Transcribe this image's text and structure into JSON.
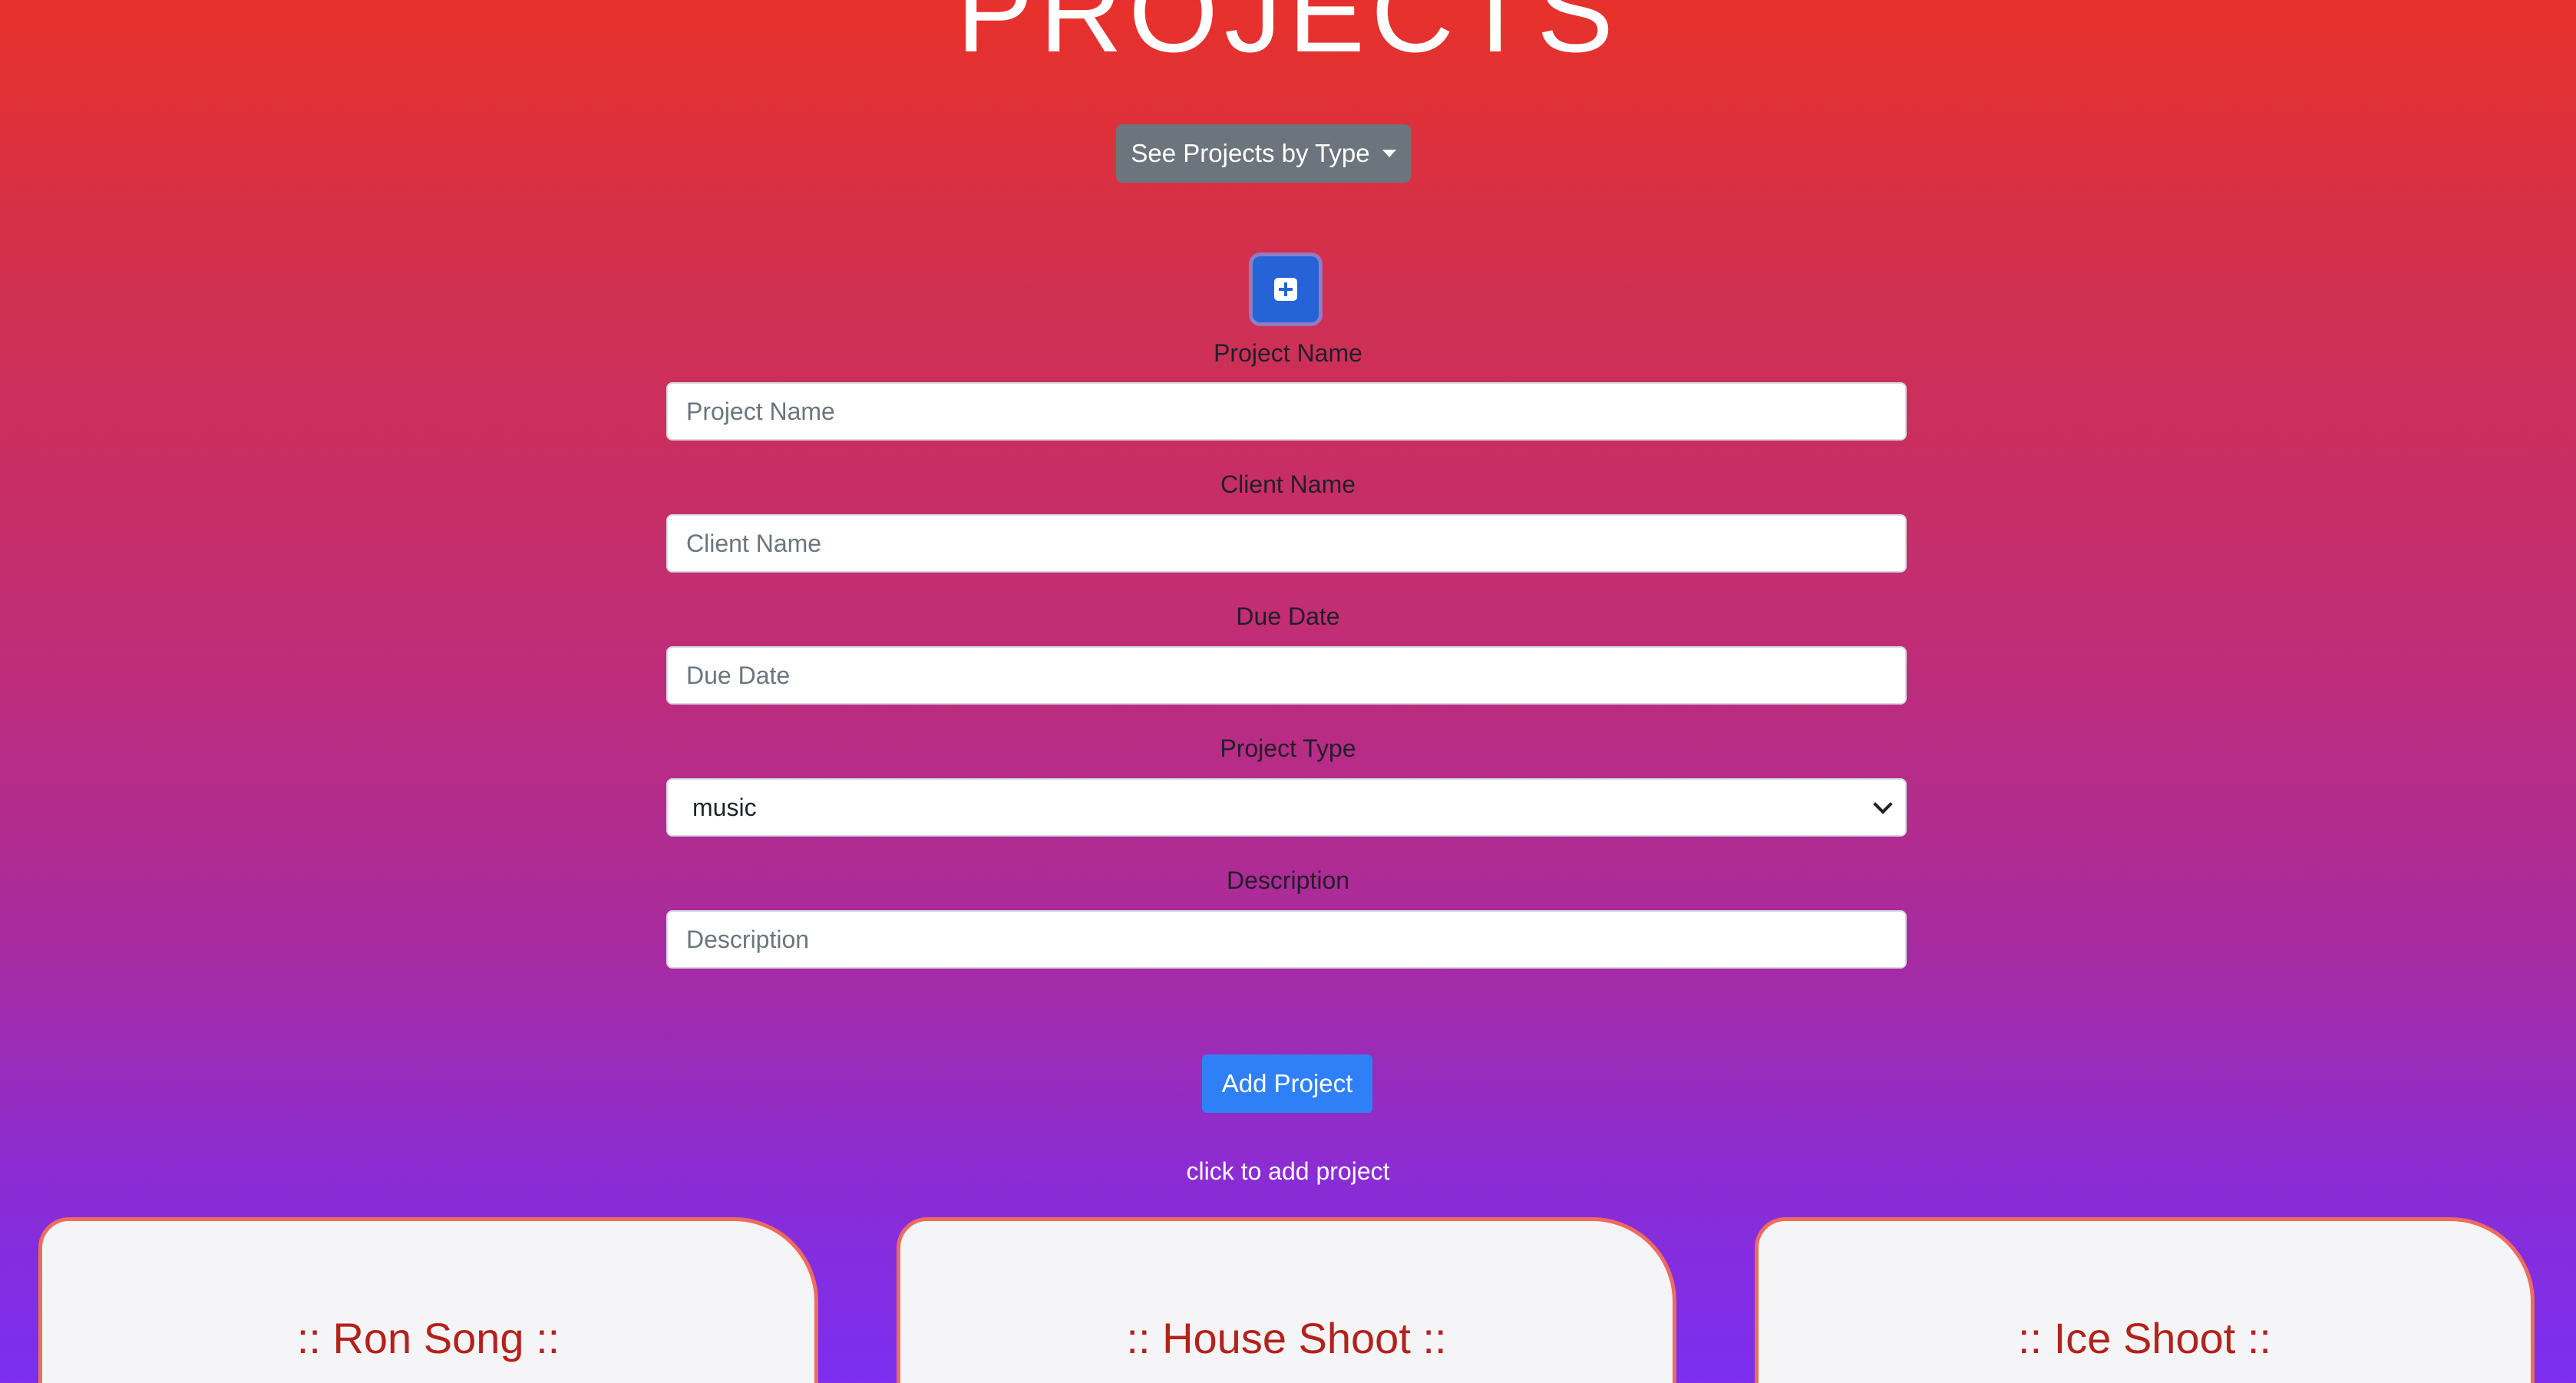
{
  "page": {
    "title": "PROJECTS"
  },
  "filter": {
    "dropdown_label": "See Projects by Type"
  },
  "form": {
    "toggle_icon": "plus-square-icon",
    "fields": {
      "project_name": {
        "label": "Project Name",
        "placeholder": "Project Name",
        "value": ""
      },
      "client_name": {
        "label": "Client Name",
        "placeholder": "Client Name",
        "value": ""
      },
      "due_date": {
        "label": "Due Date",
        "placeholder": "Due Date",
        "value": ""
      },
      "project_type": {
        "label": "Project Type",
        "selected": "music"
      },
      "description": {
        "label": "Description",
        "placeholder": "Description",
        "value": ""
      }
    },
    "submit_label": "Add Project",
    "hint": "click to add project"
  },
  "projects": [
    {
      "title": ":: Ron Song ::"
    },
    {
      "title": ":: House Shoot ::"
    },
    {
      "title": ":: Ice Shoot ::"
    }
  ],
  "colors": {
    "gradient_top": "#e8312a",
    "gradient_bottom": "#7b2ff0",
    "card_border": "#ef6b5e",
    "card_title": "#b3221b",
    "primary_button": "#2f80f6",
    "secondary_button": "#6c757d"
  }
}
